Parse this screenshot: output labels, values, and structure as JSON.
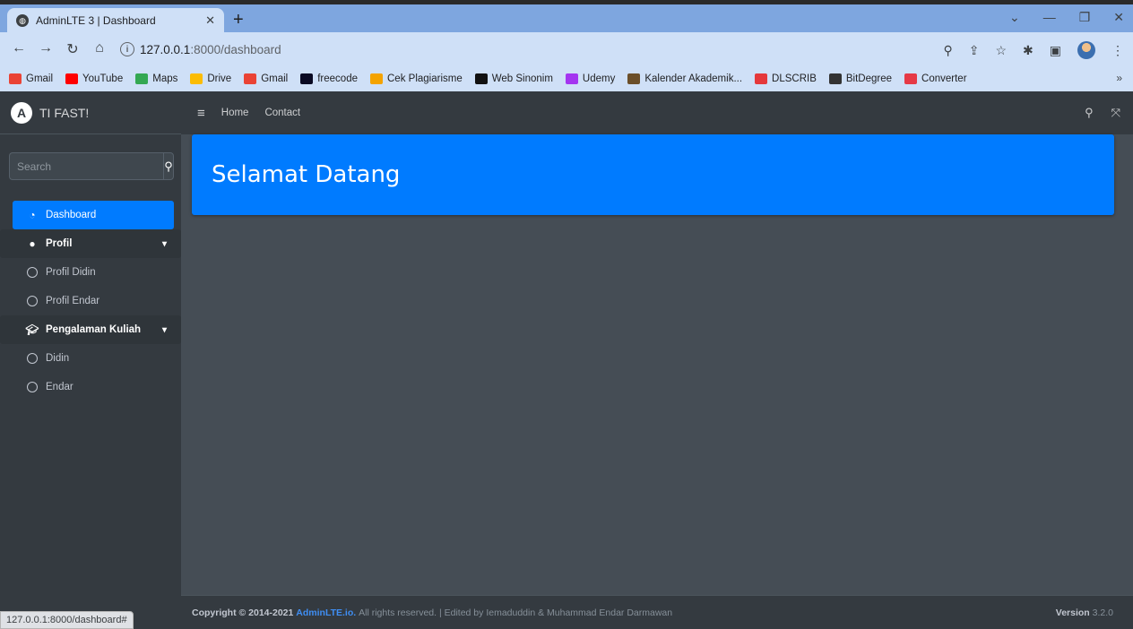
{
  "browser": {
    "tab_title": "AdminLTE 3 | Dashboard",
    "url_host": "127.0.0.1",
    "url_path": ":8000/dashboard",
    "bookmarks": [
      {
        "label": "Gmail",
        "color": "#ea4335"
      },
      {
        "label": "YouTube",
        "color": "#ff0000"
      },
      {
        "label": "Maps",
        "color": "#34a853"
      },
      {
        "label": "Drive",
        "color": "#fbbc04"
      },
      {
        "label": "Gmail",
        "color": "#ea4335"
      },
      {
        "label": "freecode",
        "color": "#0a0a23"
      },
      {
        "label": "Cek Plagiarisme",
        "color": "#f4a300"
      },
      {
        "label": "Web Sinonim",
        "color": "#111111"
      },
      {
        "label": "Udemy",
        "color": "#a435f0"
      },
      {
        "label": "Kalender Akademik...",
        "color": "#6b4f2a"
      },
      {
        "label": "DLSCRIB",
        "color": "#e5383b"
      },
      {
        "label": "BitDegree",
        "color": "#333333"
      },
      {
        "label": "Converter",
        "color": "#e63946"
      }
    ],
    "status_url": "127.0.0.1:8000/dashboard#"
  },
  "brand": {
    "name": "TI FAST!"
  },
  "sidebar": {
    "search_placeholder": "Search",
    "items": [
      {
        "label": "Dashboard"
      },
      {
        "label": "Profil"
      },
      {
        "label": "Profil Didin"
      },
      {
        "label": "Profil Endar"
      },
      {
        "label": "Pengalaman Kuliah"
      },
      {
        "label": "Didin"
      },
      {
        "label": "Endar"
      }
    ]
  },
  "topnav": {
    "home": "Home",
    "contact": "Contact"
  },
  "main": {
    "title": "Selamat Datang"
  },
  "footer": {
    "copyright": "Copyright © 2014-2021",
    "brand_link": "AdminLTE.io.",
    "rest": "All rights reserved. | Edited by Iemaduddin & Muhammad Endar Darmawan",
    "version_label": "Version",
    "version": "3.2.0"
  },
  "colors": {
    "primary": "#007bff",
    "sidebar": "#343a40",
    "content": "#454d55"
  }
}
